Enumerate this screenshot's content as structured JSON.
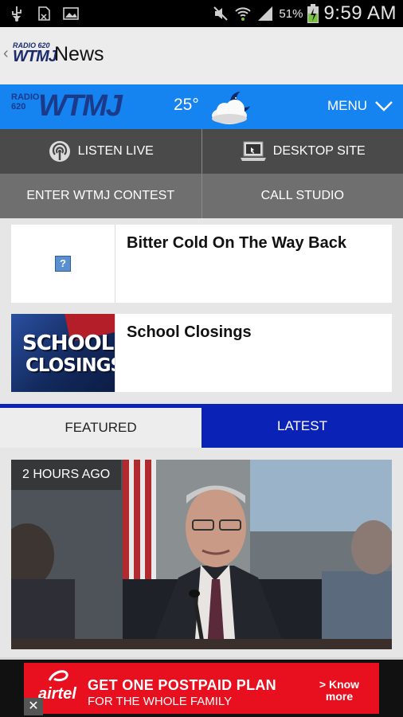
{
  "status_bar": {
    "battery_percent": "51%",
    "time": "9:59 AM",
    "icons": [
      "usb-icon",
      "sd-card-icon",
      "image-icon",
      "mute-icon",
      "wifi-icon",
      "signal-icon",
      "battery-charging-icon"
    ]
  },
  "action_bar": {
    "logo_line1": "RADIO 620",
    "logo_line2": "WTMJ",
    "title": "News"
  },
  "header": {
    "logo_small": "RADIO 620",
    "logo_big": "WTMJ",
    "temperature": "25°",
    "weather_icon": "night-cloud-icon",
    "menu_label": "MENU"
  },
  "buttons": {
    "listen_live": "LISTEN LIVE",
    "desktop_site": "DESKTOP SITE",
    "enter_contest": "ENTER WTMJ CONTEST",
    "call_studio": "CALL STUDIO"
  },
  "news": [
    {
      "title": "Bitter Cold On The Way Back",
      "thumb": "broken-image-icon"
    },
    {
      "title": "School Closings",
      "thumb_line1": "SCHOOL",
      "thumb_line2": "CLOSINGS"
    }
  ],
  "tabs": {
    "featured": "FEATURED",
    "latest": "LATEST",
    "selected": "FEATURED"
  },
  "featured": {
    "time_label": "2 HOURS AGO"
  },
  "ad": {
    "brand": "airtel",
    "headline": "GET ONE POSTPAID PLAN",
    "subline": "FOR THE WHOLE FAMILY",
    "cta": "> Know more",
    "close": "✕"
  },
  "colors": {
    "header_blue": "#1583f0",
    "tab_active_blue": "#0b22b7",
    "ad_red": "#e8101f"
  }
}
